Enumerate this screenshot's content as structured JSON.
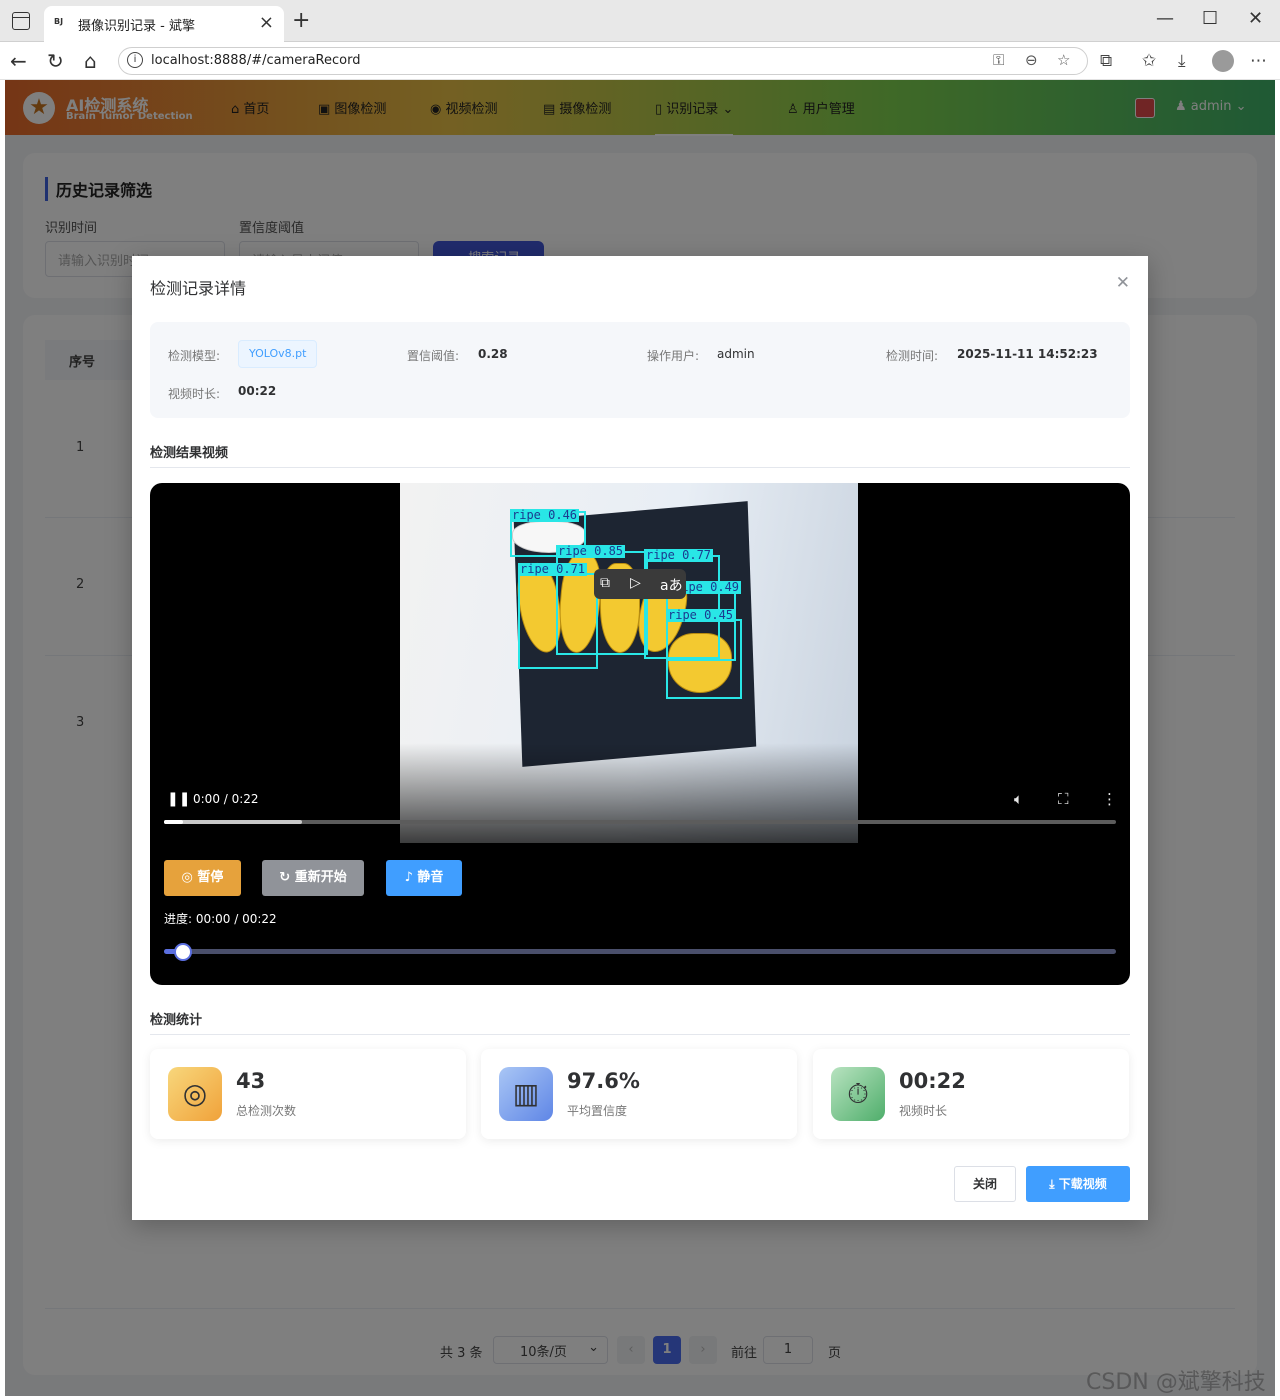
{
  "browser": {
    "tab_favicon": "BJ",
    "tab_title": "摄像识别记录 - 斌擎",
    "url": "localhost:8888/#/cameraRecord"
  },
  "app": {
    "logo_title": "AI检测系统",
    "logo_subtitle": "Brain Tumor Detection",
    "menu": [
      {
        "label": "首页",
        "icon": "home-icon"
      },
      {
        "label": "图像检测",
        "icon": "image-icon"
      },
      {
        "label": "视频检测",
        "icon": "play-circle-icon"
      },
      {
        "label": "摄像检测",
        "icon": "camera-icon"
      },
      {
        "label": "识别记录",
        "icon": "document-icon"
      },
      {
        "label": "用户管理",
        "icon": "user-icon"
      }
    ],
    "user": "admin"
  },
  "filter": {
    "title": "历史记录筛选",
    "time_label": "识别时间",
    "time_placeholder": "请输入识别时间",
    "conf_label": "置信度阈值",
    "conf_placeholder": "请输入最小阈值",
    "search_button": "搜索记录"
  },
  "table": {
    "seq_header": "序号",
    "rows": [
      "1",
      "2",
      "3"
    ]
  },
  "pagination": {
    "total": "共 3 条",
    "page_size": "10条/页",
    "current_page": "1",
    "goto_label": "前往",
    "goto_value": "1",
    "page_unit": "页"
  },
  "dialog": {
    "title": "检测记录详情",
    "info": {
      "model_label": "检测模型:",
      "model_value": "YOLOv8.pt",
      "conf_label": "置信阈值:",
      "conf_value": "0.28",
      "user_label": "操作用户:",
      "user_value": "admin",
      "time_label": "检测时间:",
      "time_value": "2025-11-11 14:52:23",
      "duration_label": "视频时长:",
      "duration_value": "00:22"
    },
    "video_section_title": "检测结果视频",
    "video": {
      "time_display": "0:00 / 0:22",
      "played_fraction": 0.02,
      "buffered_fraction": 0.145,
      "detections": [
        {
          "label": "ripe 0.46"
        },
        {
          "label": "ripe 0.85"
        },
        {
          "label": "ripe 0.77"
        },
        {
          "label": "ripe 0.71"
        },
        {
          "label": "ripe 0.49"
        },
        {
          "label": "ripe 0.45"
        }
      ],
      "buttons": {
        "pause": "暂停",
        "restart": "重新开始",
        "mute": "静音"
      },
      "progress_text": "进度: 00:00 / 00:22",
      "slider_fraction": 0.02
    },
    "stats_section_title": "检测统计",
    "stats": [
      {
        "value": "43",
        "label": "总检测次数",
        "icon": "target-icon"
      },
      {
        "value": "97.6%",
        "label": "平均置信度",
        "icon": "bar-chart-icon"
      },
      {
        "value": "00:22",
        "label": "视频时长",
        "icon": "stopwatch-icon"
      }
    ],
    "close_button": "关闭",
    "download_button": "下载视频"
  },
  "watermark": "CSDN @斌擎科技",
  "colors": {
    "primary": "#409eff",
    "accent_indigo": "#4156d9",
    "pause_button": "#e6a23c",
    "restart_button": "#909399",
    "mute_button": "#409eff",
    "detection_box": "#29e6e6"
  }
}
